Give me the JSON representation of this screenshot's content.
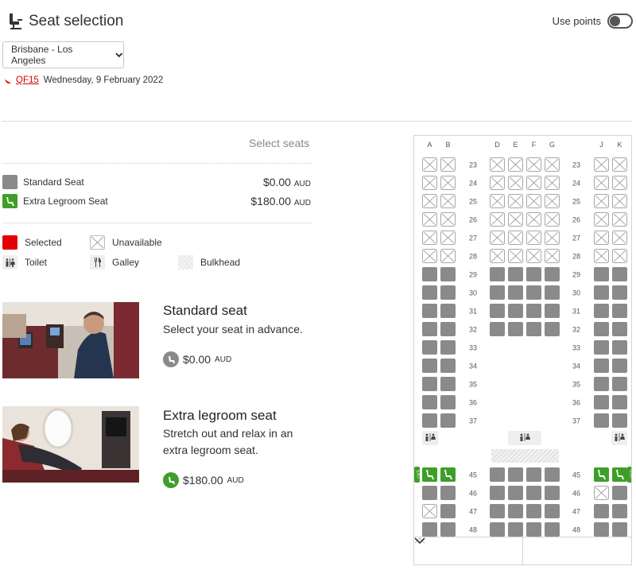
{
  "header": {
    "title": "Seat selection",
    "use_points_label": "Use points",
    "use_points_on": false
  },
  "route": {
    "selected": "Brisbane - Los Angeles",
    "flight_code": "QF15",
    "date": "Wednesday, 9 February 2022"
  },
  "legend": {
    "heading": "Select seats",
    "seat_types": [
      {
        "label": "Standard Seat",
        "price": "$0.00",
        "currency": "AUD",
        "color": "#8a8a8a"
      },
      {
        "label": "Extra Legroom Seat",
        "price": "$180.00",
        "currency": "AUD",
        "color": "#3e9f28"
      }
    ],
    "keys": {
      "selected": "Selected",
      "unavailable": "Unavailable",
      "toilet": "Toilet",
      "galley": "Galley",
      "bulkhead": "Bulkhead"
    }
  },
  "cards": [
    {
      "title": "Standard seat",
      "desc": "Select your seat in advance.",
      "price": "$0.00",
      "currency": "AUD"
    },
    {
      "title": "Extra legroom seat",
      "desc": "Stretch out and relax in an extra legroom seat.",
      "price": "$180.00",
      "currency": "AUD"
    }
  ],
  "seatmap": {
    "columns": [
      "A",
      "B",
      "D",
      "E",
      "F",
      "G",
      "J",
      "K"
    ],
    "exit_label": "EXIT",
    "rows": [
      {
        "num": "23",
        "left": [
          "x",
          "x"
        ],
        "mid": [
          "x",
          "x",
          "x",
          "x"
        ],
        "right": [
          "x",
          "x"
        ]
      },
      {
        "num": "24",
        "left": [
          "x",
          "x"
        ],
        "mid": [
          "x",
          "x",
          "x",
          "x"
        ],
        "right": [
          "x",
          "x"
        ]
      },
      {
        "num": "25",
        "left": [
          "x",
          "x"
        ],
        "mid": [
          "x",
          "x",
          "x",
          "x"
        ],
        "right": [
          "x",
          "x"
        ]
      },
      {
        "num": "26",
        "left": [
          "x",
          "x"
        ],
        "mid": [
          "x",
          "x",
          "x",
          "x"
        ],
        "right": [
          "x",
          "x"
        ]
      },
      {
        "num": "27",
        "left": [
          "x",
          "x"
        ],
        "mid": [
          "x",
          "x",
          "x",
          "x"
        ],
        "right": [
          "x",
          "x"
        ]
      },
      {
        "num": "28",
        "left": [
          "x",
          "x"
        ],
        "mid": [
          "x",
          "x",
          "x",
          "x"
        ],
        "right": [
          "x",
          "x"
        ]
      },
      {
        "num": "29",
        "left": [
          "s",
          "s"
        ],
        "mid": [
          "s",
          "s",
          "s",
          "s"
        ],
        "right": [
          "s",
          "s"
        ]
      },
      {
        "num": "30",
        "left": [
          "s",
          "s"
        ],
        "mid": [
          "s",
          "s",
          "s",
          "s"
        ],
        "right": [
          "s",
          "s"
        ]
      },
      {
        "num": "31",
        "left": [
          "s",
          "s"
        ],
        "mid": [
          "s",
          "s",
          "s",
          "s"
        ],
        "right": [
          "s",
          "s"
        ]
      },
      {
        "num": "32",
        "left": [
          "s",
          "s"
        ],
        "mid": [
          "s",
          "s",
          "s",
          "s"
        ],
        "right": [
          "s",
          "s"
        ]
      },
      {
        "num": "33",
        "left": [
          "s",
          "s"
        ],
        "mid": [],
        "right": [
          "s",
          "s"
        ]
      },
      {
        "num": "34",
        "left": [
          "s",
          "s"
        ],
        "mid": [],
        "right": [
          "s",
          "s"
        ]
      },
      {
        "num": "35",
        "left": [
          "s",
          "s"
        ],
        "mid": [],
        "right": [
          "s",
          "s"
        ]
      },
      {
        "num": "36",
        "left": [
          "s",
          "s"
        ],
        "mid": [],
        "right": [
          "s",
          "s"
        ]
      },
      {
        "num": "37",
        "left": [
          "s",
          "s"
        ],
        "mid": [],
        "right": [
          "s",
          "s"
        ]
      },
      {
        "num": "45",
        "left": [
          "g",
          "g"
        ],
        "mid": [
          "s",
          "s",
          "s",
          "s"
        ],
        "right": [
          "g",
          "g"
        ]
      },
      {
        "num": "46",
        "left": [
          "s",
          "s"
        ],
        "mid": [
          "s",
          "s",
          "s",
          "s"
        ],
        "right": [
          "x",
          "s"
        ]
      },
      {
        "num": "47",
        "left": [
          "x",
          "s"
        ],
        "mid": [
          "s",
          "s",
          "s",
          "s"
        ],
        "right": [
          "s",
          "s"
        ]
      },
      {
        "num": "48",
        "left": [
          "s",
          "s"
        ],
        "mid": [
          "s",
          "s",
          "s",
          "s"
        ],
        "right": [
          "s",
          "s"
        ]
      }
    ]
  },
  "colors": {
    "standard": "#8a8a8a",
    "extra": "#3e9f28",
    "selected": "#e40000",
    "brand": "#e40000"
  }
}
